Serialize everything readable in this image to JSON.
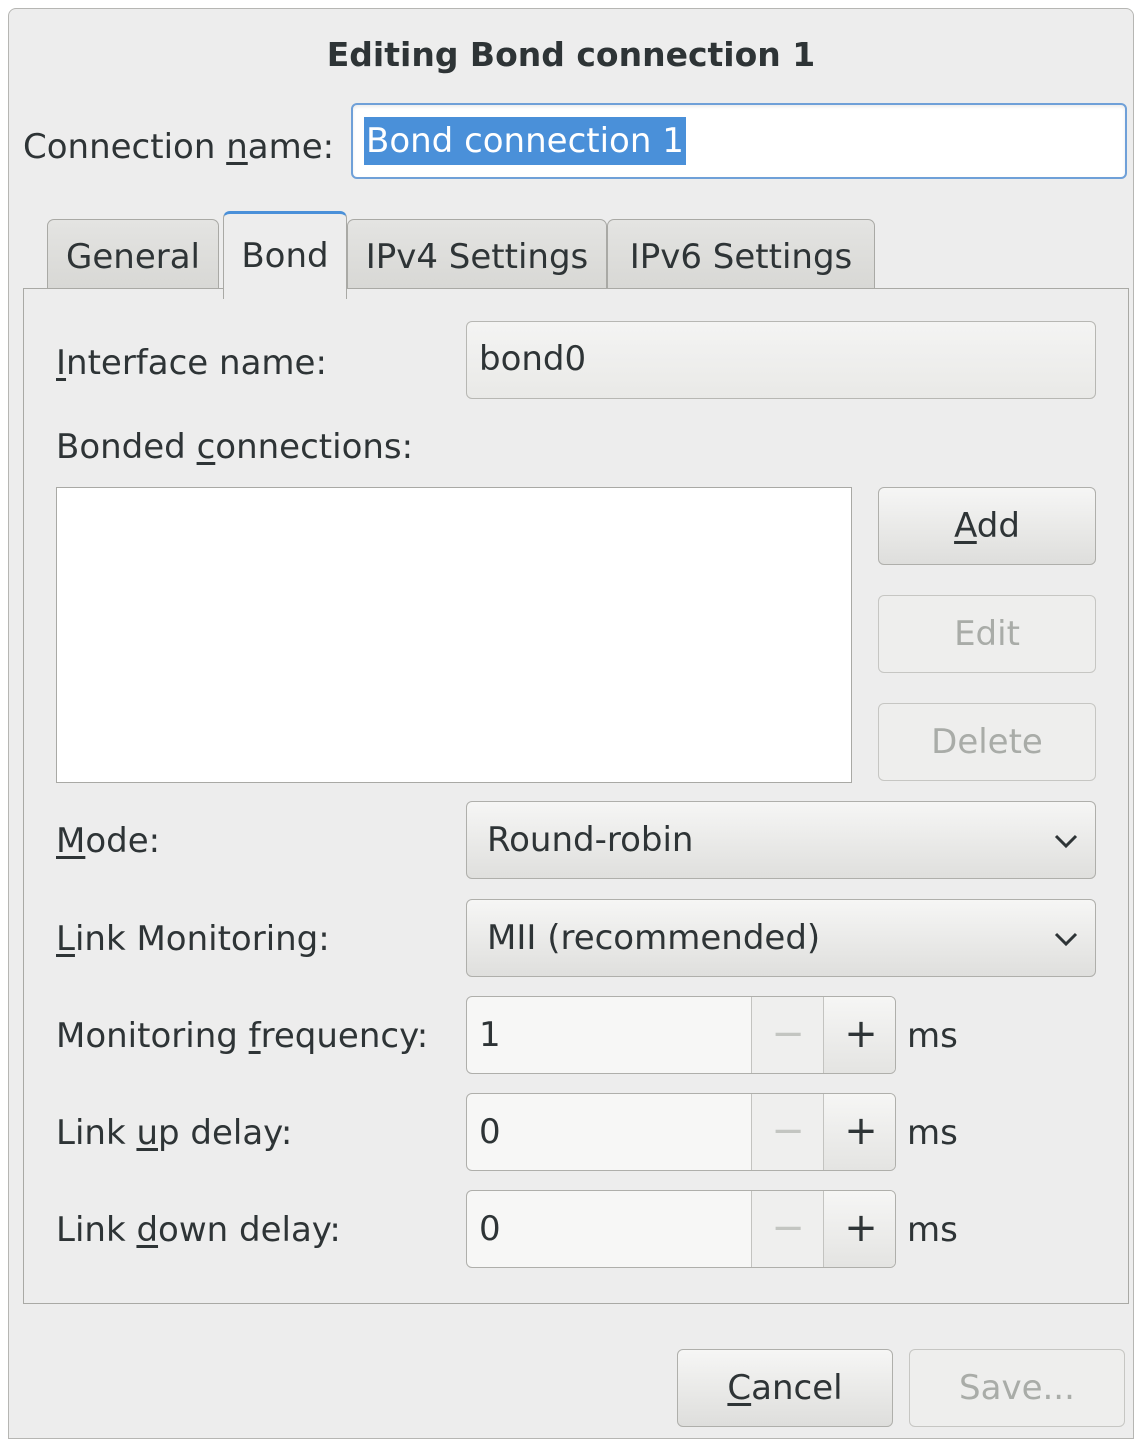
{
  "dialog": {
    "title": "Editing Bond connection 1",
    "connection_name_label_pre": "Connection ",
    "connection_name_label_u": "n",
    "connection_name_label_post": "ame:",
    "connection_name_value": "Bond connection 1"
  },
  "tabs": [
    {
      "label": "General",
      "active": false
    },
    {
      "label": "Bond",
      "active": true
    },
    {
      "label": "IPv4 Settings",
      "active": false
    },
    {
      "label": "IPv6 Settings",
      "active": false
    }
  ],
  "bond": {
    "interface_label_u": "I",
    "interface_label_post": "nterface name:",
    "interface_value": "bond0",
    "bonded_label_pre": "Bonded ",
    "bonded_label_u": "c",
    "bonded_label_post": "onnections:",
    "add_u": "A",
    "add_post": "dd",
    "edit_label": "Edit",
    "delete_label": "Delete",
    "mode_label_u": "M",
    "mode_label_post": "ode:",
    "mode_value": "Round-robin",
    "link_monitoring_label_u": "L",
    "link_monitoring_label_post": "ink Monitoring:",
    "link_monitoring_value": "MII (recommended)",
    "freq_label_pre": "Monitoring ",
    "freq_label_u": "f",
    "freq_label_post": "requency:",
    "freq_value": "1",
    "updelay_label_pre": "Link ",
    "updelay_label_u": "u",
    "updelay_label_post": "p delay:",
    "updelay_value": "0",
    "downdelay_label_pre": "Link ",
    "downdelay_label_u": "d",
    "downdelay_label_post": "own delay:",
    "downdelay_value": "0",
    "unit": "ms",
    "minus_glyph": "−",
    "plus_glyph": "+"
  },
  "footer": {
    "cancel_u": "C",
    "cancel_post": "ancel",
    "save_label": "Save..."
  },
  "colors": {
    "accent": "#4a90d9",
    "window_bg": "#ededed",
    "disabled_text": "#a9aca8"
  }
}
